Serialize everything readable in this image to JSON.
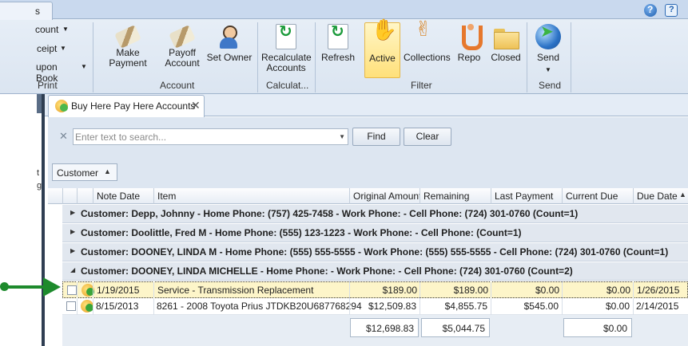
{
  "ribbon": {
    "tab_label": "s",
    "small_buttons": [
      "count",
      "ceipt",
      "upon Book"
    ],
    "print_label": "Print",
    "groups": {
      "account": "Account",
      "calculate": "Calculat...",
      "filter": "Filter",
      "send": "Send"
    },
    "buttons": {
      "make_payment": "Make Payment",
      "payoff_account_1": "Payoff",
      "payoff_account_2": "Account",
      "set_owner": "Set Owner",
      "recalculate_1": "Recalculate",
      "recalculate_2": "Accounts",
      "refresh": "Refresh",
      "active": "Active",
      "collections": "Collections",
      "repo": "Repo",
      "closed": "Closed",
      "send": "Send"
    }
  },
  "doc_tab": {
    "label": "Buy Here Pay Here Accounts"
  },
  "search": {
    "placeholder": "Enter text to search...",
    "find_label": "Find",
    "clear_label": "Clear"
  },
  "group_panel": {
    "chip_label": "Customer"
  },
  "grid": {
    "columns": [
      "Note Date",
      "Item",
      "Original Amount",
      "Remaining",
      "Last Payment",
      "Current Due",
      "Due Date"
    ],
    "groups": [
      "Customer: Depp, Johnny  - Home Phone: (757) 425-7458  - Work Phone:   - Cell Phone: (724) 301-0760  (Count=1)",
      "Customer: Doolittle, Fred M - Home Phone: (555) 123-1223  - Work Phone:   - Cell Phone:   (Count=1)",
      "Customer: DOONEY, LINDA M - Home Phone: (555) 555-5555  - Work Phone: (555) 555-5555  - Cell Phone: (724) 301-0760  (Count=1)",
      "Customer: DOONEY, LINDA MICHELLE - Home Phone:   - Work Phone:   - Cell Phone: (724) 301-0760  (Count=2)"
    ],
    "rows": [
      {
        "note_date": "1/19/2015",
        "item": "Service - Transmission Replacement",
        "original": "$189.00",
        "remaining": "$189.00",
        "last_payment": "$0.00",
        "current_due": "$0.00",
        "due_date": "1/26/2015"
      },
      {
        "note_date": "8/15/2013",
        "item": "8261 - 2008 Toyota Prius JTDKB20U687768294",
        "original": "$12,509.83",
        "remaining": "$4,855.75",
        "last_payment": "$545.00",
        "current_due": "$0.00",
        "due_date": "2/14/2015"
      }
    ],
    "totals": {
      "original": "$12,698.83",
      "remaining": "$5,044.75",
      "current_due": "$0.00"
    }
  },
  "left_strip": {
    "chars": [
      "t",
      "g"
    ]
  }
}
